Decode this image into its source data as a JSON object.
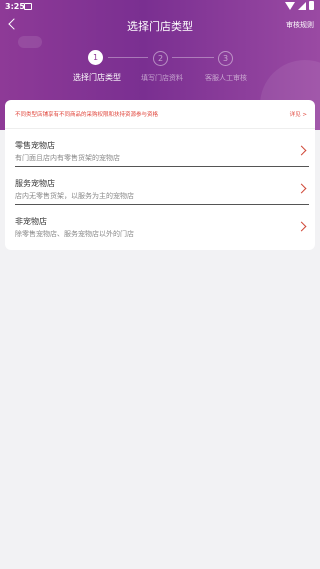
{
  "status_bar": {
    "time": "3:25"
  },
  "header": {
    "title": "选择门店类型",
    "rules_link": "审核规则"
  },
  "steps": [
    {
      "number": "1",
      "label": "选择门店类型",
      "active": true
    },
    {
      "number": "2",
      "label": "填写门店资料",
      "active": false
    },
    {
      "number": "3",
      "label": "客服人工审核",
      "active": false
    }
  ],
  "notice": {
    "text": "不同类型店铺享有不同商品的采购权限和扶持资源参与资格",
    "more": "详见 >"
  },
  "store_types": [
    {
      "name": "零售宠物店",
      "desc": "有门面且店内有零售货架的宠物店"
    },
    {
      "name": "服务宠物店",
      "desc": "店内无零售货架，以服务为主的宠物店"
    },
    {
      "name": "非宠物店",
      "desc": "除零售宠物店、服务宠物店以外的门店"
    }
  ],
  "colors": {
    "header": "#8e3a97",
    "accent": "#d04838",
    "notice": "#e0443a"
  }
}
